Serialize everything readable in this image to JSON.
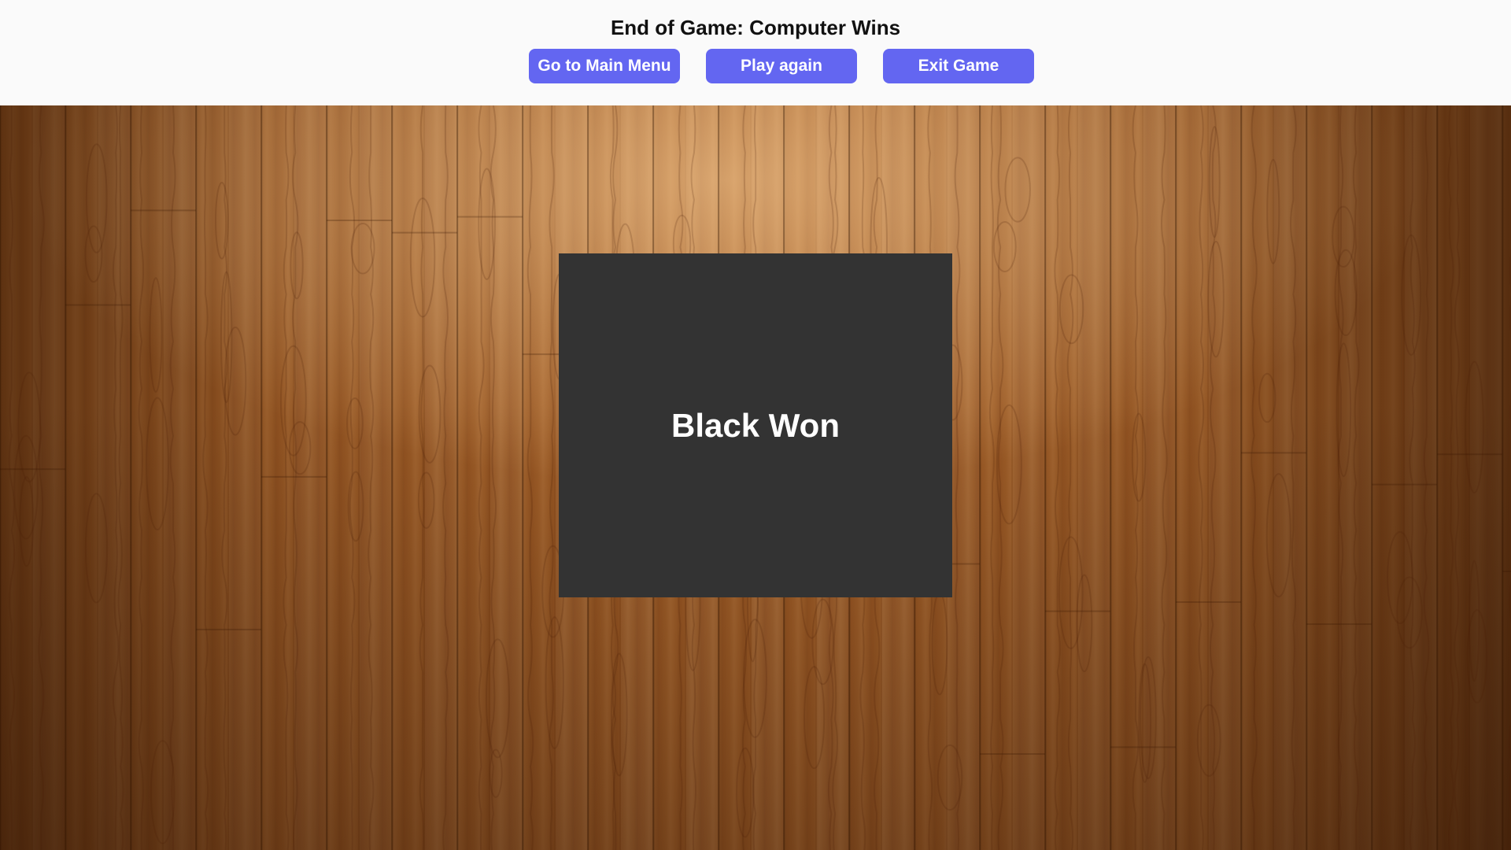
{
  "header": {
    "title": "End of Game: Computer Wins",
    "buttons": {
      "main_menu": "Go to Main Menu",
      "play_again": "Play again",
      "exit_game": "Exit Game"
    }
  },
  "board": {
    "result_text": "Black Won"
  },
  "colors": {
    "button": "#6366f1",
    "result_box": "#333333",
    "header_bg": "#fafafa"
  }
}
